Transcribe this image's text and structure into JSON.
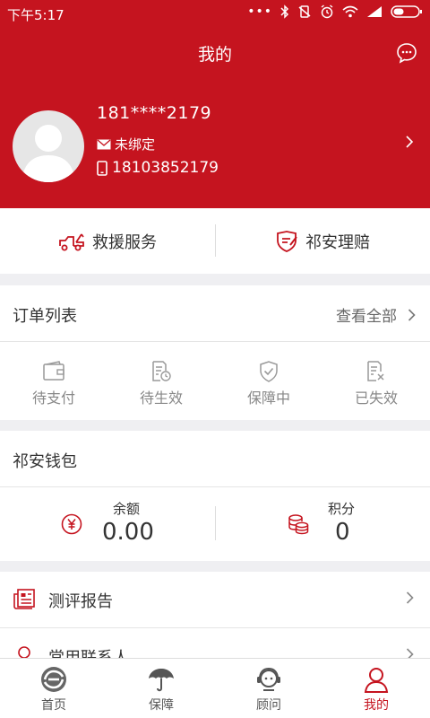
{
  "status": {
    "time": "下午5:17"
  },
  "header": {
    "title": "我的"
  },
  "profile": {
    "name": "181****2179",
    "email": "未绑定",
    "phone": "18103852179"
  },
  "services": [
    {
      "label": "救援服务"
    },
    {
      "label": "祁安理赔"
    }
  ],
  "orders": {
    "title": "订单列表",
    "see_all": "查看全部",
    "items": [
      {
        "label": "待支付"
      },
      {
        "label": "待生效"
      },
      {
        "label": "保障中"
      },
      {
        "label": "已失效"
      }
    ]
  },
  "wallet": {
    "title": "祁安钱包",
    "balance": {
      "label": "余额",
      "value": "0.00"
    },
    "points": {
      "label": "积分",
      "value": "0"
    }
  },
  "menu": [
    {
      "label": "测评报告"
    },
    {
      "label": "常用联系人"
    }
  ],
  "tabs": [
    {
      "label": "首页"
    },
    {
      "label": "保障"
    },
    {
      "label": "顾问"
    },
    {
      "label": "我的"
    }
  ],
  "colors": {
    "brand": "#c5141f",
    "background": "#efeff2"
  }
}
